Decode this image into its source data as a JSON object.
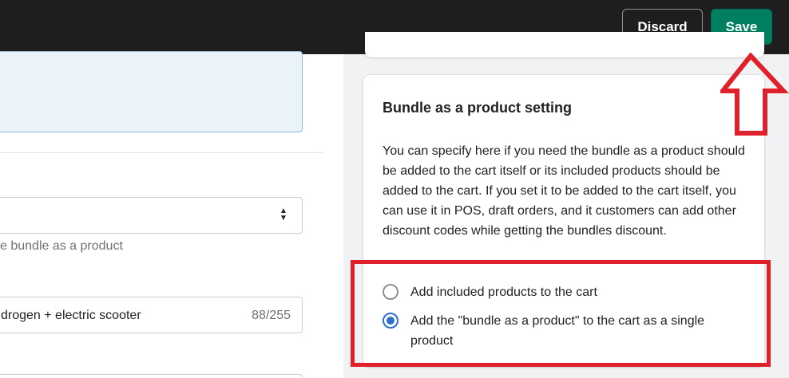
{
  "topbar": {
    "discard_label": "Discard",
    "save_label": "Save"
  },
  "left": {
    "help_text": "e bundle as a product",
    "title_field_value": "drogen + electric scooter",
    "title_field_count": "88/255"
  },
  "bundle_setting": {
    "title": "Bundle as a product setting",
    "description": "You can specify here if you need the bundle as a product should be added to the cart itself or its included products should be added to the cart. If you set it to be added to the cart itself, you can use it in POS, draft orders, and it customers can add other discount codes while getting the bundles discount.",
    "options": [
      {
        "label": "Add included products to the cart",
        "selected": false
      },
      {
        "label": "Add the \"bundle as a product\" to the cart as a single product",
        "selected": true
      }
    ]
  },
  "colors": {
    "save_green": "#008060",
    "annotation_red": "#e0202b",
    "radio_blue": "#2c6ecb"
  }
}
